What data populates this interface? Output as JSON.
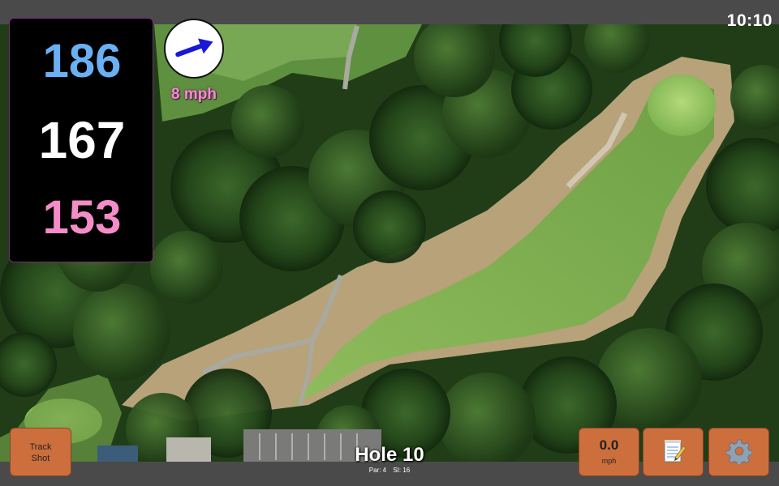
{
  "status": {
    "time": "10:10"
  },
  "distances": {
    "back": "186",
    "center": "167",
    "front": "153"
  },
  "wind": {
    "speed": "8 mph",
    "arrow_icon": "wind-direction-arrow-icon"
  },
  "buttons": {
    "track_shot_line1": "Track",
    "track_shot_line2": "Shot",
    "speed_value": "0.0",
    "speed_unit": "mph",
    "notes_icon": "notepad-icon",
    "settings_icon": "gear-icon"
  },
  "hole": {
    "title": "Hole 10",
    "par_label": "Par: 4",
    "si_label": "SI: 16"
  },
  "colors": {
    "back": "#6ab0f3",
    "center": "#ffffff",
    "front": "#f58cc8",
    "button": "#cd6f3d",
    "panel_border": "#7a2d7a",
    "wind_arrow": "#1a17d6"
  }
}
